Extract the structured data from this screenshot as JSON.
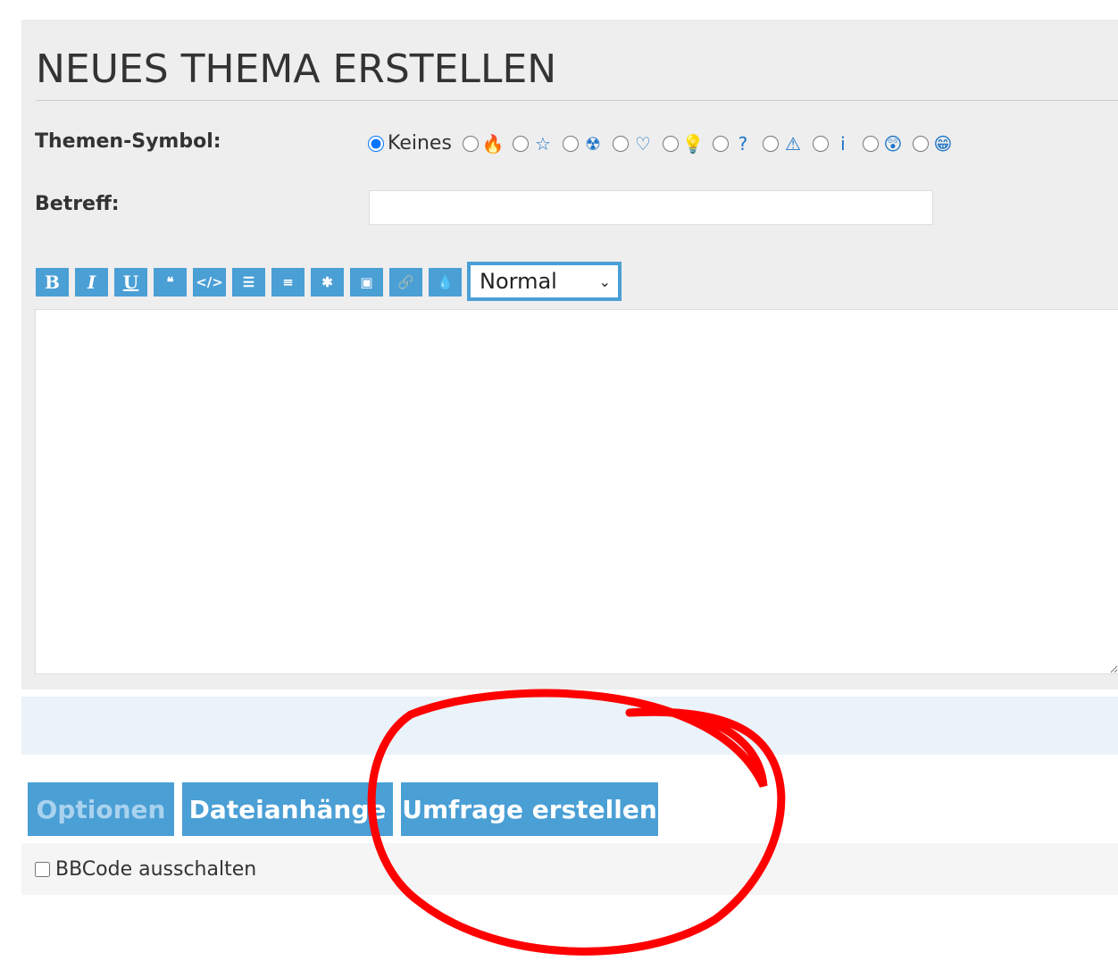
{
  "title": "NEUES THEMA ERSTELLEN",
  "topic_icon": {
    "label": "Themen-Symbol:",
    "none_label": "Keines",
    "selected": "none",
    "icons": [
      {
        "name": "fire-icon",
        "glyph": "🔥"
      },
      {
        "name": "star-icon",
        "glyph": "☆"
      },
      {
        "name": "radioactive-icon",
        "glyph": "☢"
      },
      {
        "name": "heart-icon",
        "glyph": "♡"
      },
      {
        "name": "lightbulb-icon",
        "glyph": "💡"
      },
      {
        "name": "question-icon",
        "glyph": "?"
      },
      {
        "name": "warning-icon",
        "glyph": "⚠"
      },
      {
        "name": "info-icon",
        "glyph": "i"
      },
      {
        "name": "surprised-face-icon",
        "glyph": "😲"
      },
      {
        "name": "grin-face-icon",
        "glyph": "😁"
      }
    ]
  },
  "subject": {
    "label": "Betreff:",
    "value": ""
  },
  "toolbar": {
    "buttons": [
      {
        "name": "bold",
        "glyph": "B"
      },
      {
        "name": "italic",
        "glyph": "I"
      },
      {
        "name": "underline",
        "glyph": "U"
      },
      {
        "name": "quote",
        "glyph": "❝"
      },
      {
        "name": "code",
        "glyph": "</>"
      },
      {
        "name": "list",
        "glyph": "☰"
      },
      {
        "name": "ordered-list",
        "glyph": "≡"
      },
      {
        "name": "asterisk",
        "glyph": "✱"
      },
      {
        "name": "image",
        "glyph": "▣"
      },
      {
        "name": "link",
        "glyph": "🔗"
      },
      {
        "name": "color",
        "glyph": "💧"
      }
    ],
    "font_size": "Normal"
  },
  "tabs": {
    "options": "Optionen",
    "attachments": "Dateianhänge",
    "poll": "Umfrage erstellen"
  },
  "bbcode": {
    "label": "BBCode ausschalten",
    "checked": false
  },
  "colors": {
    "accent": "#4a9fd5",
    "annotation": "#ff0000"
  }
}
